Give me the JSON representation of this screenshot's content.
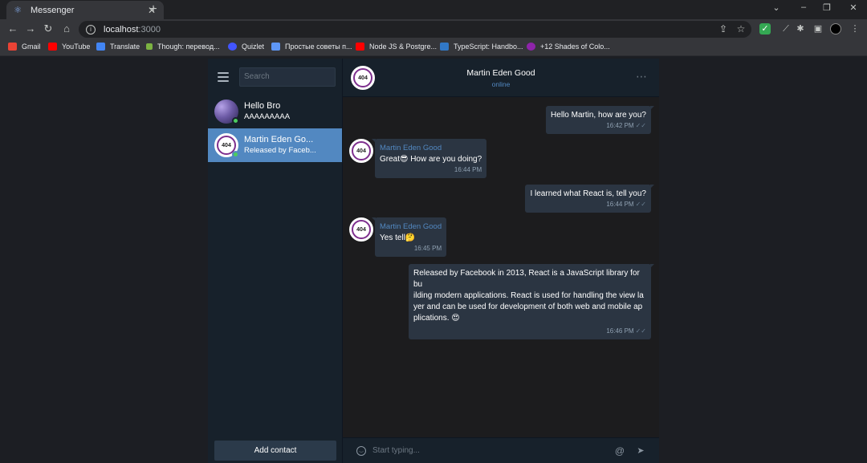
{
  "browser": {
    "tab_title": "Messenger",
    "tab_favicon": "react-icon",
    "url_host": "localhost",
    "url_port": ":3000",
    "bookmarks": [
      {
        "label": "Gmail",
        "icon": "gmail-icon",
        "color": "#ea4335"
      },
      {
        "label": "YouTube",
        "icon": "youtube-icon",
        "color": "#ff0000"
      },
      {
        "label": "Translate",
        "icon": "translate-icon",
        "color": "#4285f4"
      },
      {
        "label": "Though: перевод...",
        "icon": "bookmark-icon",
        "color": "#7cb342"
      },
      {
        "label": "Quizlet",
        "icon": "quizlet-icon",
        "color": "#4255ff"
      },
      {
        "label": "Простые советы п...",
        "icon": "bookmark-icon",
        "color": "#5e97f6"
      },
      {
        "label": "Node JS & Postgre...",
        "icon": "youtube-icon",
        "color": "#ff0000"
      },
      {
        "label": "TypeScript: Handbo...",
        "icon": "typescript-icon",
        "color": "#3178c6"
      },
      {
        "label": "+12 Shades of Colo...",
        "icon": "bookmark-icon",
        "color": "#8e24aa"
      }
    ]
  },
  "sidebar": {
    "search_placeholder": "Search",
    "chats": [
      {
        "name": "Hello Bro",
        "last_message": "AAAAAAAAA",
        "avatar": "photo",
        "online": true,
        "active": false
      },
      {
        "name": "Martin Eden Go...",
        "last_message": "Released by Faceb...",
        "avatar": "404",
        "online": true,
        "active": true
      }
    ],
    "add_contact_label": "Add contact"
  },
  "chat": {
    "name": "Martin Eden Good",
    "status": "online",
    "avatar_text": "404",
    "composer_placeholder": "Start typing...",
    "messages": [
      {
        "direction": "out",
        "text": "Hello Martin, how are you?",
        "time": "16:42 PM",
        "ticks": "✓✓"
      },
      {
        "direction": "in",
        "sender": "Martin Eden Good",
        "text": "Great😎 How are you doing?",
        "time": "16:44 PM"
      },
      {
        "direction": "out",
        "text": "I learned what React is, tell you?",
        "time": "16:44 PM",
        "ticks": "✓✓"
      },
      {
        "direction": "in",
        "sender": "Martin Eden Good",
        "text": "Yes tell🤔",
        "time": "16:45 PM"
      },
      {
        "direction": "out",
        "text_lines": [
          "Released by Facebook in 2013, React is a JavaScript library for bu",
          "ilding modern applications. React is used for handling the view la",
          "yer and can be used for development of both web and mobile ap",
          "plications. 😍"
        ],
        "time": "16:46 PM",
        "ticks": "✓✓"
      }
    ]
  },
  "colors": {
    "accent": "#5288c1",
    "online": "#4dcd5e",
    "sidebar_bg": "#17212b",
    "bubble_bg": "#2b3542"
  }
}
